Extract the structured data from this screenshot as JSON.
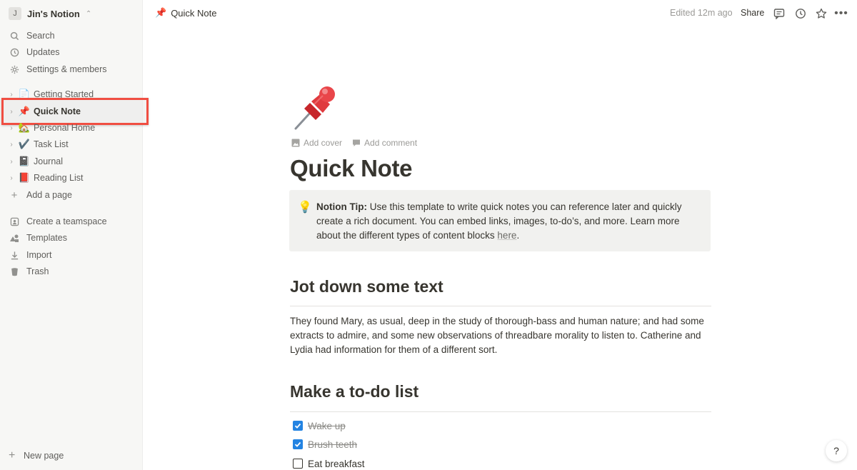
{
  "workspace": {
    "avatar_letter": "J",
    "name": "Jin's Notion"
  },
  "sidebar": {
    "nav": [
      {
        "label": "Search",
        "icon": "search-icon"
      },
      {
        "label": "Updates",
        "icon": "clock-icon"
      },
      {
        "label": "Settings & members",
        "icon": "gear-icon"
      }
    ],
    "pages": [
      {
        "emoji": "📄",
        "label": "Getting Started"
      },
      {
        "emoji": "📌",
        "label": "Quick Note",
        "active": true
      },
      {
        "emoji": "🏡",
        "label": "Personal Home"
      },
      {
        "emoji": "✔️",
        "label": "Task List"
      },
      {
        "emoji": "📓",
        "label": "Journal"
      },
      {
        "emoji": "📕",
        "label": "Reading List"
      }
    ],
    "add_page": "Add a page",
    "tools": [
      {
        "label": "Create a teamspace",
        "icon": "teamspace-icon"
      },
      {
        "label": "Templates",
        "icon": "templates-icon"
      },
      {
        "label": "Import",
        "icon": "import-icon"
      },
      {
        "label": "Trash",
        "icon": "trash-icon"
      }
    ],
    "new_page": "New page"
  },
  "topbar": {
    "crumb_emoji": "📌",
    "crumb_title": "Quick Note",
    "edited": "Edited 12m ago",
    "share": "Share"
  },
  "page": {
    "icon": "pushpin-icon",
    "add_cover": "Add cover",
    "add_comment": "Add comment",
    "title": "Quick Note",
    "callout": {
      "emoji": "💡",
      "bold": "Notion Tip:",
      "text": " Use this template to write quick notes you can reference later and quickly create a rich document. You can embed links, images, to-do’s, and more. Learn more about the different types of content blocks ",
      "link": "here",
      "end": "."
    },
    "section1": {
      "heading": "Jot down some text",
      "paragraph": "They found Mary, as usual, deep in the study of thorough-bass and human nature; and had some extracts to admire, and some new observations of threadbare morality to listen to. Catherine and Lydia had information for them of a different sort."
    },
    "section2": {
      "heading": "Make a to-do list",
      "todos": [
        {
          "text": "Wake up",
          "checked": true
        },
        {
          "text": "Brush teeth",
          "checked": true
        },
        {
          "text": "Eat breakfast",
          "checked": false
        }
      ]
    }
  },
  "help": "?",
  "colors": {
    "accent": "#2383e2",
    "highlight_border": "#f04e42",
    "sidebar_bg": "#f7f7f5"
  }
}
